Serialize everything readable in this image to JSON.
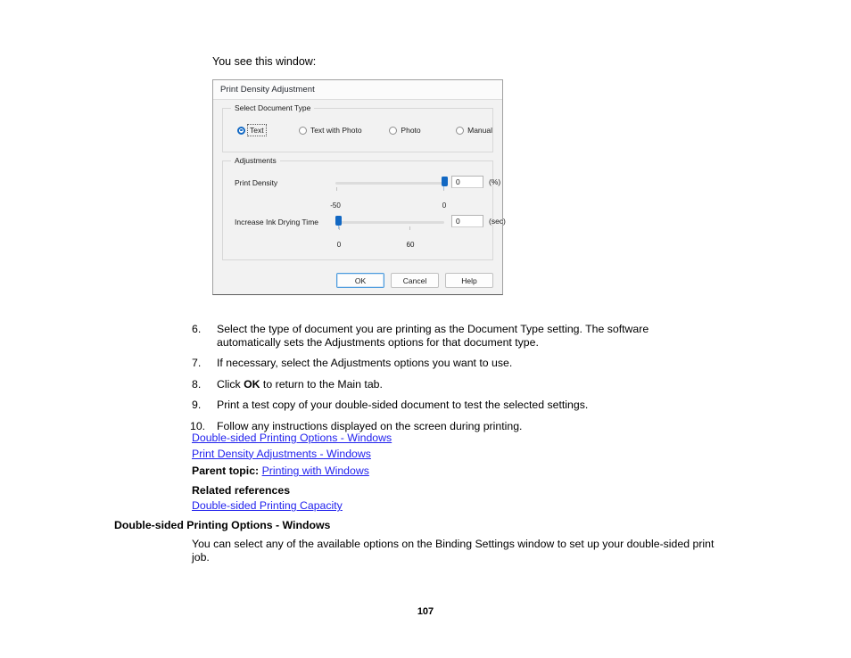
{
  "document": {
    "intro_line": "You see this window:",
    "page_number": "107"
  },
  "dialog": {
    "title": "Print Density Adjustment",
    "document_type_group": {
      "label": "Select Document Type",
      "options": [
        {
          "label": "Text",
          "selected": true,
          "focused": true
        },
        {
          "label": "Text with Photo",
          "selected": false,
          "focused": false
        },
        {
          "label": "Photo",
          "selected": false,
          "focused": false
        },
        {
          "label": "Manual",
          "selected": false,
          "focused": false
        }
      ]
    },
    "adjustments_group": {
      "label": "Adjustments",
      "rows": [
        {
          "label": "Print Density",
          "value": "0",
          "unit": "(%)",
          "min_label": "-50",
          "max_label": "0",
          "thumb_percent": 100
        },
        {
          "label": "Increase Ink Drying Time",
          "value": "0",
          "unit": "(sec)",
          "min_label": "0",
          "max_label": "60",
          "thumb_percent": 3
        }
      ]
    },
    "buttons": [
      {
        "label": "OK",
        "default": true
      },
      {
        "label": "Cancel",
        "default": false
      },
      {
        "label": "Help",
        "default": false
      }
    ]
  },
  "steps": [
    {
      "num": "6.",
      "text": "Select the type of document you are printing as the Document Type setting. The software automatically sets the Adjustments options for that document type."
    },
    {
      "num": "7.",
      "text": "If necessary, select the Adjustments options you want to use."
    },
    {
      "num": "8.",
      "text_before": "Click ",
      "bold": "OK",
      "text_after": " to return to the Main tab."
    },
    {
      "num": "9.",
      "text": "Print a test copy of your double-sided document to test the selected settings."
    },
    {
      "num": "10.",
      "text": "Follow any instructions displayed on the screen during printing."
    }
  ],
  "links_section": {
    "link_1": "Double-sided Printing Options - Windows",
    "link_2": "Print Density Adjustments - Windows",
    "parent_label": "Parent topic:",
    "parent_link": "Printing with Windows",
    "related_heading": "Related references",
    "related_link": "Double-sided Printing Capacity"
  },
  "section": {
    "heading": "Double-sided Printing Options - Windows",
    "body": "You can select any of the available options on the Binding Settings window to set up your double-sided print job."
  },
  "colors": {
    "link": "#2222ee",
    "accent": "#1268c3"
  }
}
